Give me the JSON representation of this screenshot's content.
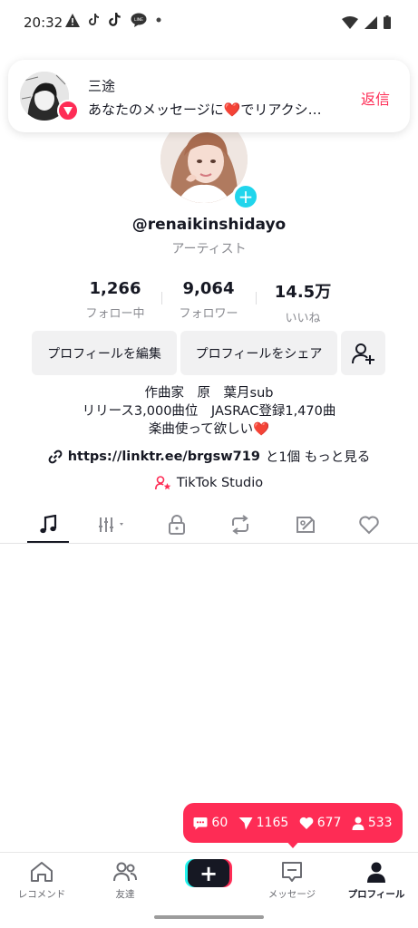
{
  "status_bar": {
    "time": "20:32"
  },
  "notification": {
    "sender": "三途",
    "message": "あなたのメッセージに❤️でリアクシ…",
    "reply_label": "返信"
  },
  "profile": {
    "username": "@renaikinshidayo",
    "category": "アーティスト",
    "stats": [
      {
        "value": "1,266",
        "label": "フォロー中"
      },
      {
        "value": "9,064",
        "label": "フォロワー"
      },
      {
        "value": "14.5万",
        "label": "いいね"
      }
    ],
    "edit_button": "プロフィールを編集",
    "share_button": "プロフィールをシェア",
    "bio_lines": [
      "作曲家　原　葉月sub",
      "リリース3,000曲位　JASRAC登録1,470曲",
      "楽曲使って欲しい❤️"
    ],
    "link_text": "https://linktr.ee/brgsw719",
    "link_more": "と1個 もっと見る",
    "studio_label": "TikTok Studio"
  },
  "tabs": [
    {
      "icon": "music-note-icon"
    },
    {
      "icon": "filter-bars-icon"
    },
    {
      "icon": "lock-icon"
    },
    {
      "icon": "repost-icon"
    },
    {
      "icon": "tag-icon"
    },
    {
      "icon": "heart-outline-icon"
    }
  ],
  "live_stats": {
    "comments": "60",
    "shares": "1165",
    "likes": "677",
    "followers": "533"
  },
  "bottom_nav": {
    "home": "レコメンド",
    "friends": "友達",
    "messages": "メッセージ",
    "profile": "プロフィール"
  },
  "colors": {
    "accent": "#fe2c55",
    "cyan": "#20d5ec",
    "text": "#161823",
    "muted": "#8a8b91"
  }
}
